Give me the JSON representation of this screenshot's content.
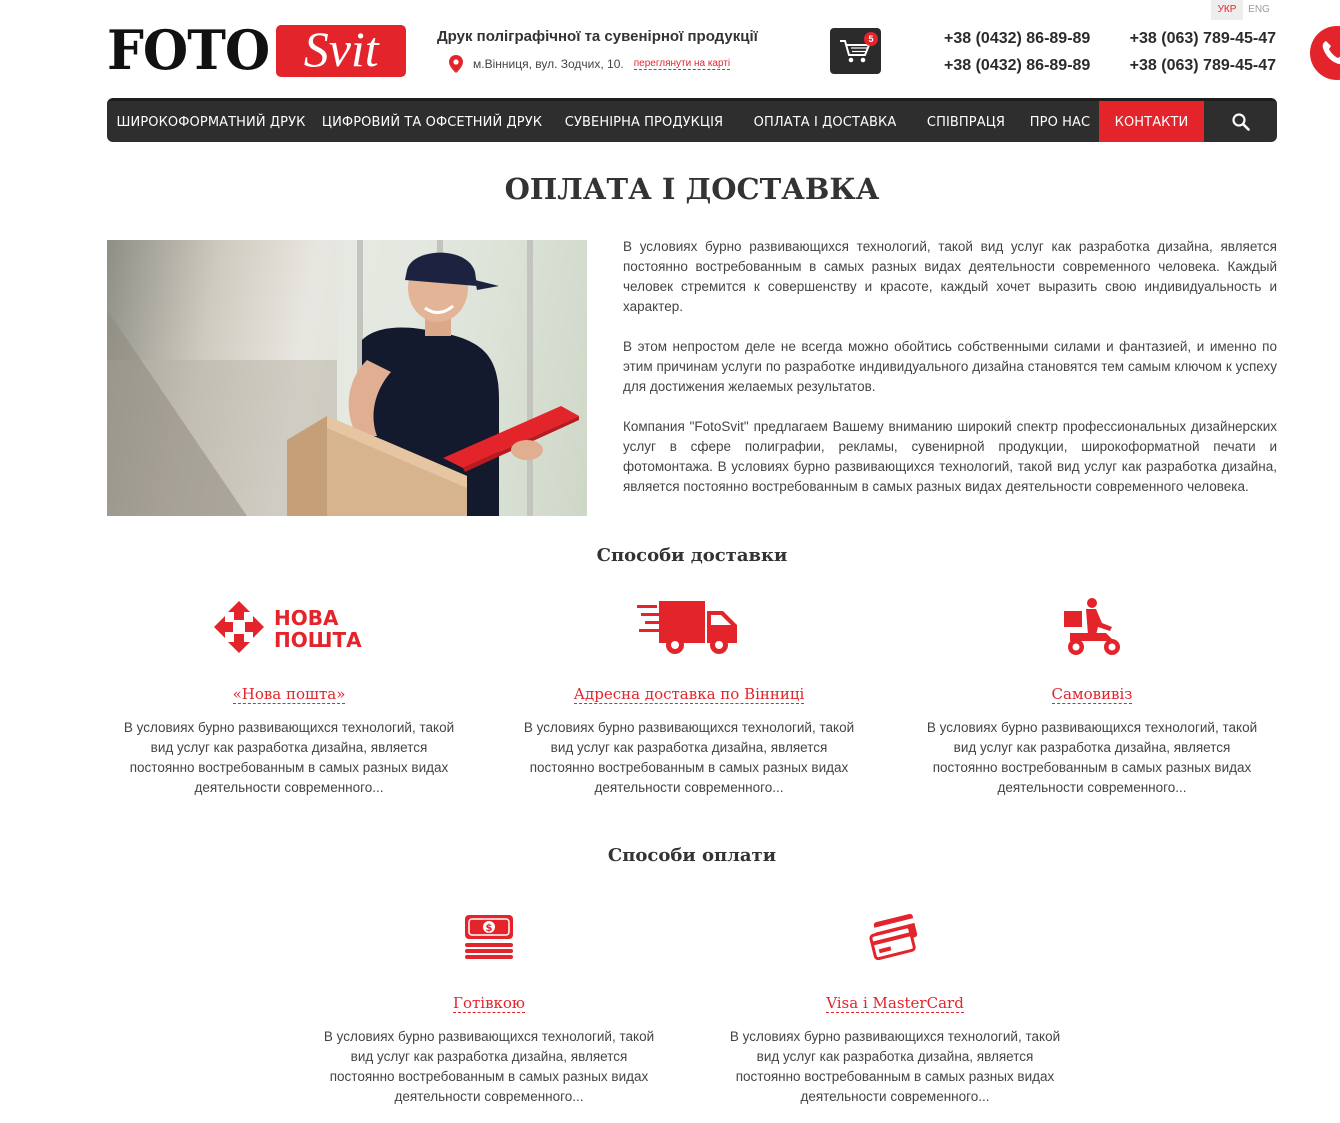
{
  "lang": {
    "ukr": "УКР",
    "eng": "ENG"
  },
  "logo": {
    "part1": "FOTO",
    "part2": "Svit"
  },
  "header": {
    "tagline": "Друк поліграфічної та сувенірної продукції",
    "address": "м.Вінниця, вул. Зодчих, 10.",
    "map_link": "переглянути на карті",
    "cart_count": "5",
    "phones": [
      "+38 (0432) 86-89-89",
      "+38 (063) 789-45-47",
      "+38 (0432) 86-89-89",
      "+38 (063) 789-45-47"
    ]
  },
  "nav": {
    "items": [
      "ШИРОКОФОРМАТНИЙ ДРУК",
      "ЦИФРОВИЙ ТА ОФСЕТНИЙ ДРУК",
      "СУВЕНІРНА ПРОДУКЦІЯ",
      "ОПЛАТА І ДОСТАВКА",
      "СПІВПРАЦЯ",
      "ПРО НАС",
      "КОНТАКТИ"
    ]
  },
  "page": {
    "title": "ОПЛАТА І ДОСТАВКА",
    "paragraphs": [
      "В условиях бурно развивающихся технологий, такой вид услуг как разработка дизайна, является постоянно востребованным в самых разных видах деятельности современного человека. Каждый человек стремится к совершенству и красоте, каждый хочет выразить свою индивидуальность и характер.",
      "В этом непростом деле не всегда можно обойтись собственными силами и фантазией, и именно по этим причинам услуги по разработке индивидуального дизайна становятся тем самым ключом к успеху для достижения желаемых результатов.",
      "Компания \"FotoSvit\" предлагаем Вашему вниманию широкий спектр профессиональных дизайнерских услуг в сфере полиграфии, рекламы, сувенирной продукции, широкоформатной печати и фотомонтажа. В условиях бурно развивающихся технологий, такой вид услуг как разработка дизайна, является постоянно востребованным в самых разных видах деятельности современного человека."
    ]
  },
  "delivery": {
    "title": "Способи доставки",
    "nova_logo": [
      "НОВА",
      "ПОШТА"
    ],
    "items": [
      {
        "title": "«Нова пошта»",
        "text": "В условиях бурно развивающихся технологий, такой вид услуг как разработка дизайна, является постоянно востребованным в самых разных видах деятельности современного..."
      },
      {
        "title": "Адресна доставка по Вінниці",
        "text": "В условиях бурно развивающихся технологий, такой вид услуг как разработка дизайна, является постоянно востребованным в самых разных видах деятельности современного..."
      },
      {
        "title": "Самовивіз",
        "text": "В условиях бурно развивающихся технологий, такой вид услуг как разработка дизайна, является постоянно востребованным в самых разных видах деятельности современного..."
      }
    ]
  },
  "payment": {
    "title": "Способи оплати",
    "items": [
      {
        "title": "Готівкою",
        "text": "В условиях бурно развивающихся технологий, такой вид услуг как разработка дизайна, является постоянно востребованным в самых разных видах деятельности современного..."
      },
      {
        "title": "Visa і MasterCard",
        "text": "В условиях бурно развивающихся технологий, такой вид услуг как разработка дизайна, является постоянно востребованным в самых разных видах деятельности современного..."
      }
    ]
  },
  "colors": {
    "accent": "#e3242b",
    "nav_bg": "#2e2e2e",
    "text": "#333333"
  }
}
